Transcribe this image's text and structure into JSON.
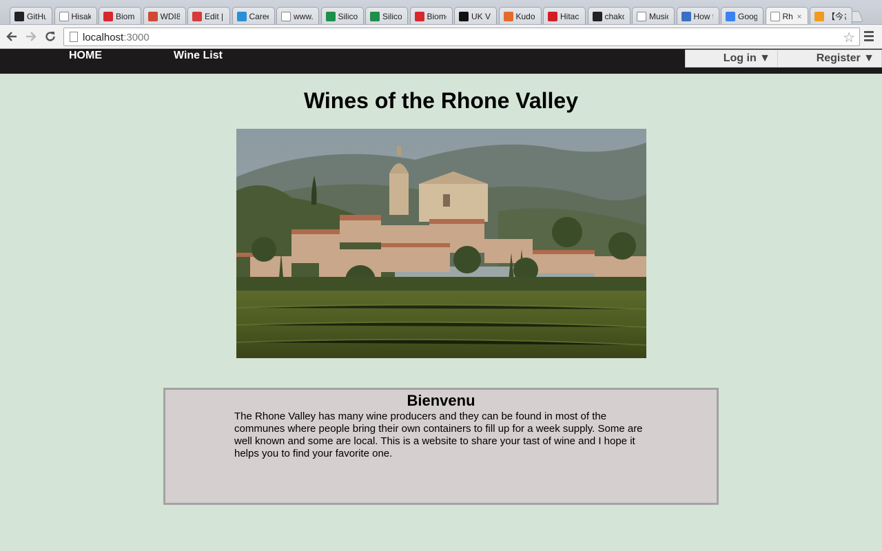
{
  "browser": {
    "tabs": [
      {
        "label": "GitHu",
        "favicon": "github-icon",
        "color": "#222222"
      },
      {
        "label": "Hisak",
        "favicon": "page-icon",
        "color": "#ffffff"
      },
      {
        "label": "Biome",
        "favicon": "biomed-icon",
        "color": "#d9272e"
      },
      {
        "label": "WDI8",
        "favicon": "gmail-icon",
        "color": "#d14836"
      },
      {
        "label": "Edit |",
        "favicon": "edit-icon",
        "color": "#d63a3a"
      },
      {
        "label": "Caree",
        "favicon": "ie-icon",
        "color": "#2b8fd8"
      },
      {
        "label": "www.",
        "favicon": "page-icon",
        "color": "#ffffff"
      },
      {
        "label": "Silico",
        "favicon": "sheet-icon",
        "color": "#1e8f4a"
      },
      {
        "label": "Silico",
        "favicon": "sheet-icon",
        "color": "#1e8f4a"
      },
      {
        "label": "Biome",
        "favicon": "biomed-icon",
        "color": "#d9272e"
      },
      {
        "label": "UK Vi",
        "favicon": "ukvi-icon",
        "color": "#111111"
      },
      {
        "label": "Kudo",
        "favicon": "kudos-icon",
        "color": "#e66a2c"
      },
      {
        "label": "Hitach",
        "favicon": "hitachi-icon",
        "color": "#d21f26"
      },
      {
        "label": "chako",
        "favicon": "github-icon",
        "color": "#222222"
      },
      {
        "label": "Music",
        "favicon": "page-icon",
        "color": "#ffffff"
      },
      {
        "label": "How t",
        "favicon": "monitor-icon",
        "color": "#3a6fc4"
      },
      {
        "label": "Goog",
        "favicon": "translate-icon",
        "color": "#3b82f0"
      },
      {
        "label": "Rh",
        "favicon": "page-icon",
        "color": "#ffffff",
        "active": true
      },
      {
        "label": "【今さ",
        "favicon": "blog-icon",
        "color": "#f29a1d"
      }
    ],
    "close_glyph": "×",
    "url_host": "localhost",
    "url_port": ":3000"
  },
  "site": {
    "nav": {
      "home": "HOME",
      "wine_list": "Wine List"
    },
    "auth": {
      "login": "Log in ▼",
      "register": "Register ▼"
    }
  },
  "main": {
    "title": "Wines of the Rhone Valley",
    "welcome": {
      "title": "Bienvenu",
      "text": "The Rhone Valley has many wine producers and they can be found in most of the communes where people bring their own containers to fill up for a week supply. Some are well known and some are local. This is a website to share your tast of wine and I hope it helps you to find your favorite one."
    }
  },
  "colors": {
    "page_bg": "#d4e4d6",
    "nav_bg": "#1c1a1b",
    "welcome_bg": "#d5cfd0",
    "welcome_border": "#a3a3a3"
  }
}
